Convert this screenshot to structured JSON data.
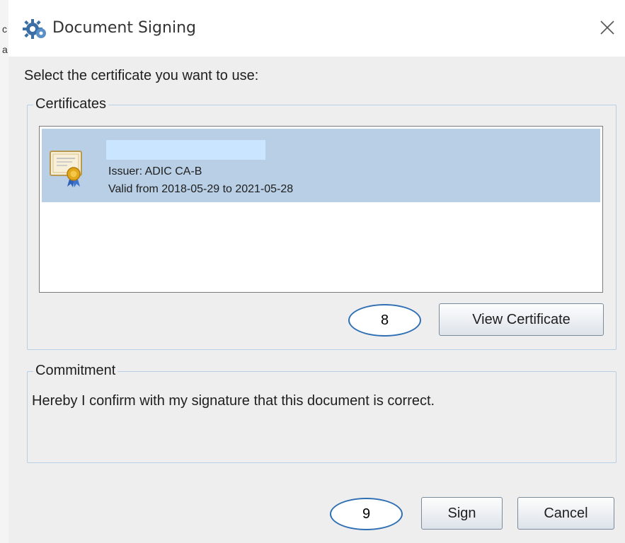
{
  "background_window": {
    "fragments": [
      "c",
      "a"
    ]
  },
  "dialog": {
    "title": "Document Signing",
    "prompt": "Select the certificate you want to use:",
    "certificates": {
      "legend": "Certificates",
      "items": [
        {
          "issuer": "Issuer: ADIC CA-B",
          "validity": "Valid from 2018-05-29 to 2021-05-28",
          "selected": true
        }
      ],
      "view_button": "View Certificate"
    },
    "commitment": {
      "legend": "Commitment",
      "text": "Hereby I confirm with my signature that this document is correct."
    },
    "buttons": {
      "sign": "Sign",
      "cancel": "Cancel"
    }
  },
  "annotations": {
    "callout_8": "8",
    "callout_9": "9"
  },
  "colors": {
    "selection": "#b8cfe5",
    "redaction": "#c9e5ff",
    "dialog_bg": "#eeeeee",
    "callout_border": "#2f6fb3"
  },
  "icons": {
    "app": "gear-app-icon",
    "close": "close-icon",
    "certificate": "certificate-icon"
  }
}
